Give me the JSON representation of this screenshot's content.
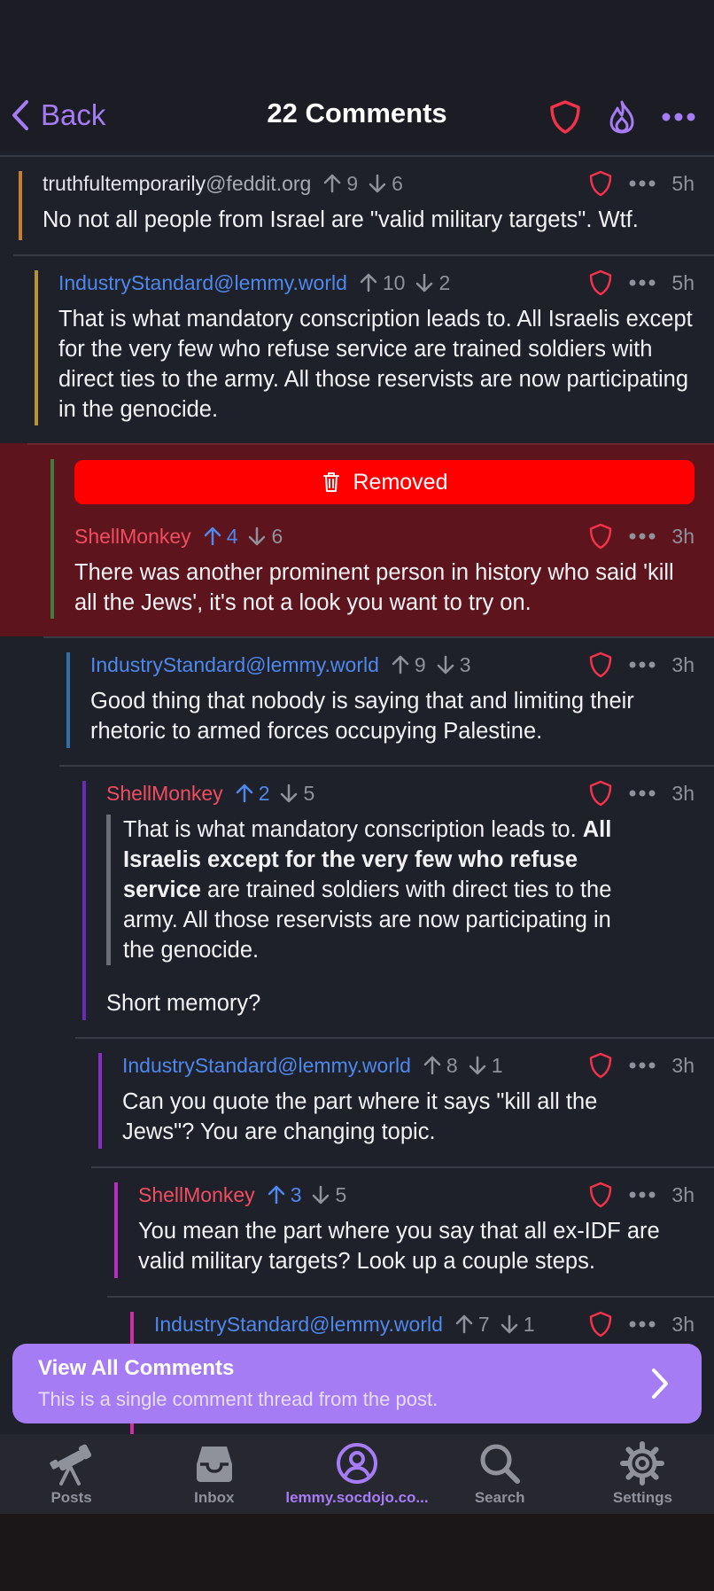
{
  "nav": {
    "back_label": "Back",
    "title": "22 Comments"
  },
  "comments": [
    {
      "user": "truthfultemporarily",
      "instance": "@feddit.org",
      "up": "9",
      "down": "6",
      "age": "5h",
      "body": "No not all people from Israel are \"valid military targets\". Wtf."
    },
    {
      "user": "IndustryStandard",
      "instance": "@lemmy.world",
      "up": "10",
      "down": "2",
      "age": "5h",
      "body": "That is what mandatory conscription leads to. All Israelis except for the very few who refuse service are trained soldiers with direct ties to the army. All those reservists are now participating in the genocide."
    },
    {
      "removed_label": "Removed",
      "user": "ShellMonkey",
      "up": "4",
      "down": "6",
      "age": "3h",
      "body": "There was another prominent person in history who said 'kill all the Jews', it's not a look you want to try on."
    },
    {
      "user": "IndustryStandard",
      "instance": "@lemmy.world",
      "up": "9",
      "down": "3",
      "age": "3h",
      "body": "Good thing that nobody is saying that and limiting their rhetoric to armed forces occupying Palestine."
    },
    {
      "user": "ShellMonkey",
      "up": "2",
      "down": "5",
      "age": "3h",
      "quote_pre": "That is what mandatory conscription leads to.",
      "quote_bold": "All Israelis except for the very few who refuse service",
      "quote_post": "are trained soldiers with direct ties to the army. All those reservists are now participating in the genocide.",
      "body": "Short memory?"
    },
    {
      "user": "IndustryStandard",
      "instance": "@lemmy.world",
      "up": "8",
      "down": "1",
      "age": "3h",
      "body": "Can you quote the part where it says \"kill all the Jews\"? You are changing topic."
    },
    {
      "user": "ShellMonkey",
      "up": "3",
      "down": "5",
      "age": "3h",
      "body": "You mean the part where you say that all ex-IDF are valid military targets? Look up a couple steps."
    },
    {
      "user": "IndustryStandard",
      "instance": "@lemmy.world",
      "up": "7",
      "down": "1",
      "age": "3h"
    }
  ],
  "banner": {
    "title": "View All Comments",
    "subtitle": "This is a single comment thread from the post."
  },
  "tabs": [
    {
      "label": "Posts",
      "icon": "telescope-icon"
    },
    {
      "label": "Inbox",
      "icon": "inbox-icon"
    },
    {
      "label": "lemmy.socdojo.co...",
      "icon": "account-icon"
    },
    {
      "label": "Search",
      "icon": "search-icon"
    },
    {
      "label": "Settings",
      "icon": "gear-icon"
    }
  ],
  "colors": {
    "accent": "#a67cf5",
    "background": "#1e202a",
    "removed_bg": "#5e141d",
    "removed_button": "#ff0000",
    "username_blue": "#4f88ec",
    "username_red": "#f04e60",
    "shield_red": "#f0334a"
  }
}
